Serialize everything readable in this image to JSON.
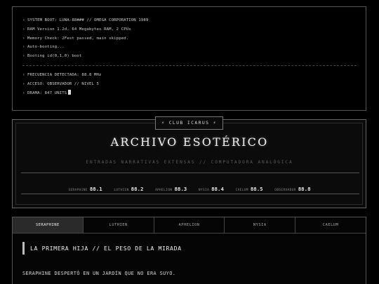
{
  "terminal": {
    "lines_top": [
      "› SYSTEM BOOT: LUNA-88### // OMEGA CORPORATION 1989",
      "› RAM Version 1.2d, 64 Megabytes RAM, 2 CPUs",
      "› Memory Check: 2Fest passed, main skipped.",
      "› Auto-booting...",
      "› Booting id(0,1,0) boot"
    ],
    "lines_bottom": [
      "› FRECUENCIA DETECTADA: 88.8 MHz",
      "› ACCESO: OBSERVADOR // NIVEL 5",
      "› DRAMA: 847 UNITS"
    ]
  },
  "header": {
    "badge": "⚡ CLUB ICARUS ⚡",
    "title": "ARCHIVO ESOTÉRICO",
    "subtitle": "ENTRADAS NARRATIVAS EXTENSAS // COMPUTADORA ANALÓGICA",
    "frequencies": [
      {
        "name": "SERAPHINE",
        "value": "88.1"
      },
      {
        "name": "LUTHIEN",
        "value": "88.2"
      },
      {
        "name": "APHELION",
        "value": "88.3"
      },
      {
        "name": "NYSIA",
        "value": "88.4"
      },
      {
        "name": "CAELUM",
        "value": "88.5"
      },
      {
        "name": "OBSERVADOR",
        "value": "88.8"
      }
    ]
  },
  "tabs": [
    {
      "label": "SERAPHINE",
      "active": true
    },
    {
      "label": "LUTHIEN",
      "active": false
    },
    {
      "label": "APHELION",
      "active": false
    },
    {
      "label": "NYSIA",
      "active": false
    },
    {
      "label": "CAELUM",
      "active": false
    }
  ],
  "story": {
    "title": "LA PRIMERA HIJA // EL PESO DE LA MIRADA",
    "text": "SERAPHINE DESPERTÓ EN UN JARDÍN QUE NO ERA SUYO."
  }
}
